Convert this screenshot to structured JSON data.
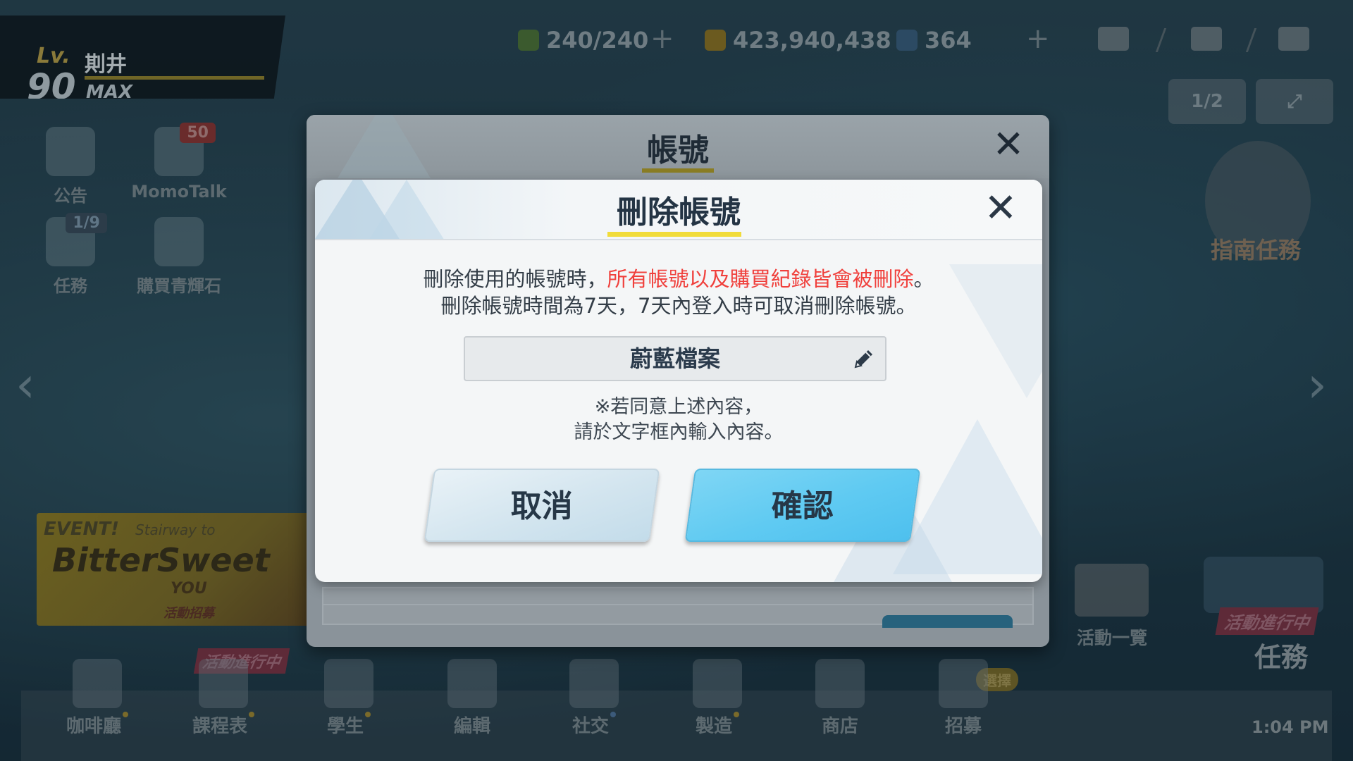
{
  "player": {
    "level_label": "Lv.",
    "level": "90",
    "name": "剘井",
    "max_label": "MAX"
  },
  "resources": {
    "ap": "240/240",
    "credits": "423,940,438",
    "gems": "364"
  },
  "top_right": {
    "page_indicator": "1/2"
  },
  "left_menu": [
    {
      "label": "公告"
    },
    {
      "label": "MomoTalk",
      "badge": "50"
    },
    {
      "label": "任務",
      "badge": "1/9"
    },
    {
      "label": "購買青輝石"
    }
  ],
  "event_banner": {
    "event_label": "EVENT!",
    "subtitle": "Stairway to",
    "name": "BitterSweet",
    "you": "YOU",
    "tag": "活動招募"
  },
  "right_side": {
    "guide_label": "指南任務",
    "event_list_label": "活動一覽",
    "mission_tag": "活動進行中",
    "mission_label": "任務"
  },
  "bottom_nav": {
    "items": [
      "咖啡廳",
      "課程表",
      "學生",
      "編輯",
      "社交",
      "製造",
      "商店",
      "招募"
    ],
    "schedule_tag": "活動進行中",
    "recruit_tag": "選擇",
    "clock": "1:04 PM"
  },
  "outer_dialog": {
    "title": "帳號",
    "close_icon": "close-icon"
  },
  "delete_dialog": {
    "title": "刪除帳號",
    "close_icon": "close-icon",
    "warning_prefix": "刪除使用的帳號時，",
    "warning_red": "所有帳號以及購買紀錄皆會被刪除",
    "warning_suffix": "。",
    "warning_line2": "刪除帳號時間為7天，7天內登入時可取消刪除帳號。",
    "input_value": "蔚藍檔案",
    "input_icon": "pencil-icon",
    "note_line1": "※若同意上述內容，",
    "note_line2": "請於文字框內輸入內容。",
    "cancel_label": "取消",
    "confirm_label": "確認"
  },
  "colors": {
    "warning_red": "#f0403c",
    "title_underline": "#f1dc3a",
    "confirm_blue": "#5fcaf2",
    "cancel_blue": "#d3e5ef"
  }
}
